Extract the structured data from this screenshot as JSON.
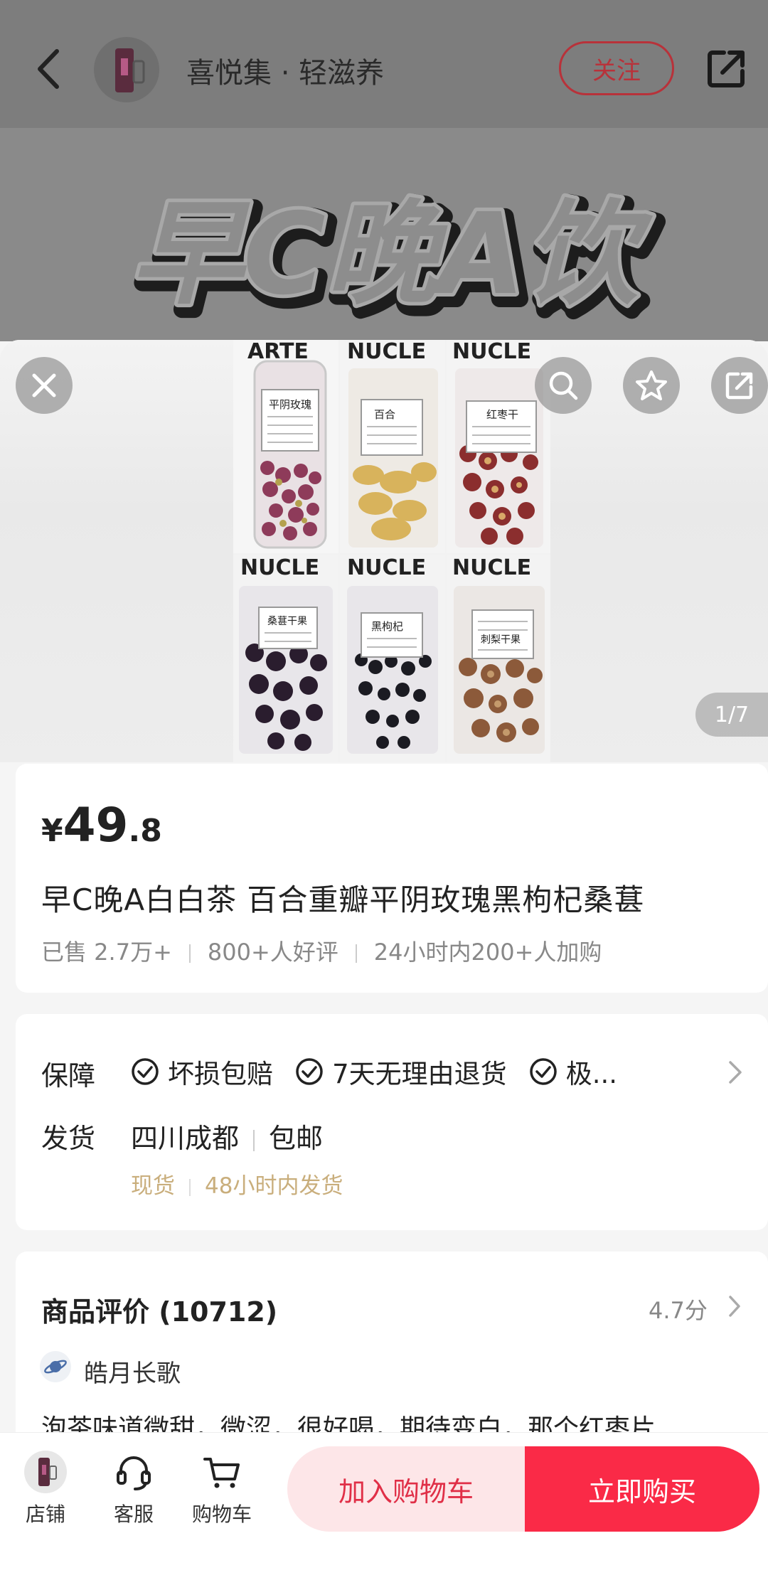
{
  "header": {
    "shop_name": "喜悦集 · 轻滋养",
    "follow_label": "关注"
  },
  "banner": {
    "text": "早C晚A饮"
  },
  "gallery": {
    "page_indicator": "1/7",
    "product_labels": [
      "平阴玫瑰",
      "百合",
      "红枣干",
      "桑葚干果",
      "黑枸杞",
      "刺梨干果"
    ]
  },
  "product": {
    "price_symbol": "¥",
    "price_int": "49",
    "price_dec": ".8",
    "title": "早C晚A白白茶 百合重瓣平阴玫瑰黑枸杞桑葚",
    "stats": [
      "已售 2.7万+",
      "800+人好评",
      "24小时内200+人加购"
    ]
  },
  "service": {
    "guarantee_label": "保障",
    "guarantees": [
      "坏损包赔",
      "7天无理由退货",
      "极..."
    ],
    "shipping_label": "发货",
    "origin": "四川成都",
    "shipping_fee": "包邮",
    "stock": "现货",
    "dispatch": "48小时内发货"
  },
  "reviews": {
    "title": "商品评价 (10712)",
    "score": "4.7分",
    "reviewer": "皓月长歌",
    "snippet": "泡茶味道微甜，微涩，很好喝，期待变白，那个红枣片"
  },
  "bottom_bar": {
    "store_label": "店铺",
    "service_label": "客服",
    "cart_label": "购物车",
    "add_to_cart": "加入购物车",
    "buy_now": "立即购买"
  },
  "colors": {
    "accent": "#fa2a47",
    "cart_bg": "#fde6e8",
    "dispatch_gold": "#c9ae7c"
  }
}
